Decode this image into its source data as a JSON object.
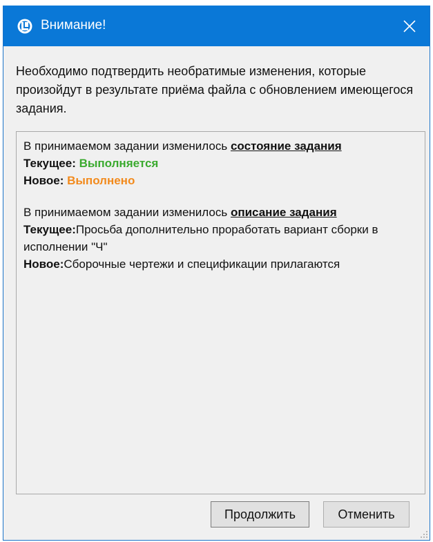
{
  "window": {
    "title": "Внимание!",
    "app_icon": "app-logo-icon",
    "close_icon": "close-icon"
  },
  "intro_text": "Необходимо подтвердить необратимые изменения, которые произойдут в результате приёма файла с обновлением имеющегося задания.",
  "changes": [
    {
      "prefix": "В принимаемом задании изменилось ",
      "field": "состояние задания",
      "current_label": "Текущее:",
      "current_value": "Выполняется",
      "new_label": "Новое:",
      "new_value": "Выполнено"
    },
    {
      "prefix": "В принимаемом задании изменилось ",
      "field": "описание задания",
      "current_label": "Текущее:",
      "current_value": "Просьба дополнительно проработать вариант сборки в исполнении \"Ч\"",
      "new_label": "Новое:",
      "new_value": "Сборочные чертежи и спецификации прилагаются"
    }
  ],
  "buttons": {
    "continue_label": "Продолжить",
    "cancel_label": "Отменить"
  },
  "colors": {
    "titlebar": "#0a78d7",
    "current_status": "#3aaa2e",
    "new_status": "#f28a1c"
  }
}
